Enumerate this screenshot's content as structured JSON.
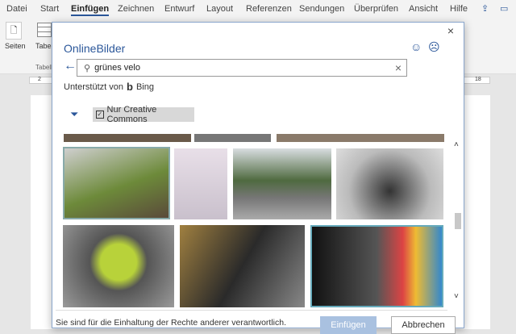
{
  "ribbon": {
    "tabs": [
      "Datei",
      "Start",
      "Einfügen",
      "Zeichnen",
      "Entwurf",
      "Layout",
      "Referenzen",
      "Sendungen",
      "Überprüfen",
      "Ansicht",
      "Hilfe"
    ],
    "active": "Einfügen",
    "seiten": "Seiten",
    "tabelle": "Tabe",
    "tabelle_group": "Tabell"
  },
  "ruler": {
    "left": "2",
    "right": "18"
  },
  "dialog": {
    "title": "OnlineBilder",
    "search_value": "grünes velo",
    "powered_by": "Unterstützt von",
    "bing": "Bing",
    "filter_label": "Nur Creative Commons",
    "filter_checked": true,
    "footer_text": "Sie sind für die Einhaltung der Rechte anderer verantwortlich.",
    "insert_label": "Einfügen",
    "cancel_label": "Abbrechen"
  }
}
